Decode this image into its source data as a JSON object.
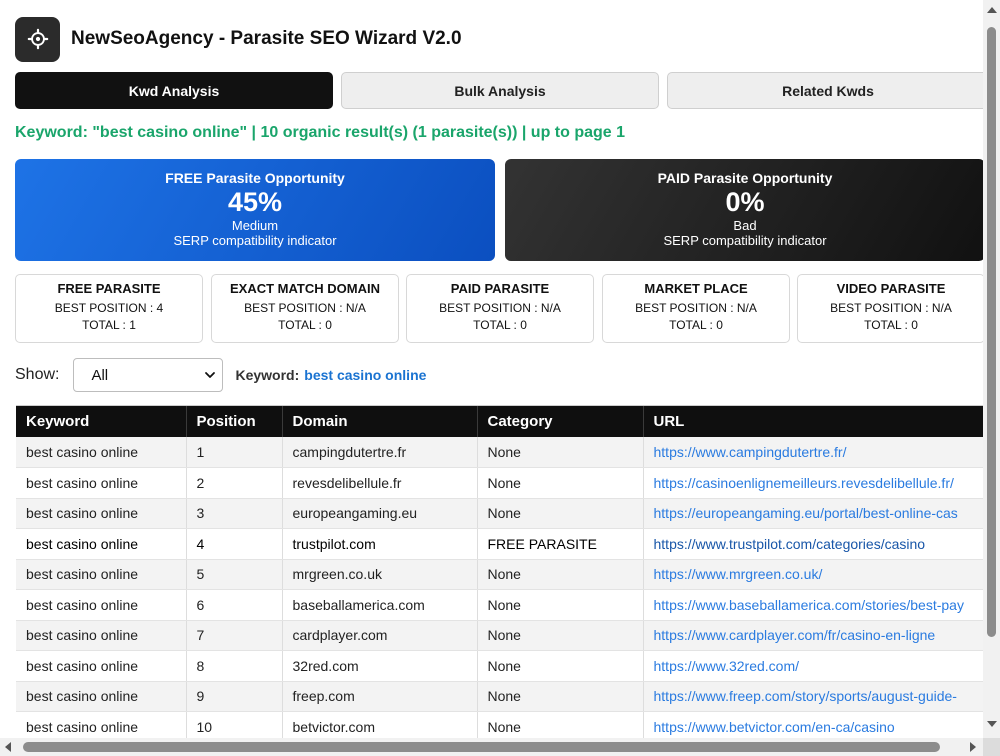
{
  "app": {
    "title": "NewSeoAgency - Parasite SEO Wizard V2.0",
    "logo_icon": "gear-icon"
  },
  "tabs": [
    {
      "label": "Kwd Analysis",
      "active": true
    },
    {
      "label": "Bulk Analysis",
      "active": false
    },
    {
      "label": "Related Kwds",
      "active": false
    }
  ],
  "summary": "Keyword: \"best casino online\" | 10 organic result(s) (1 parasite(s)) | up to page 1",
  "opportunities": {
    "free": {
      "title": "FREE Parasite Opportunity",
      "value": "45%",
      "rating": "Medium",
      "caption": "SERP compatibility indicator"
    },
    "paid": {
      "title": "PAID Parasite Opportunity",
      "value": "0%",
      "rating": "Bad",
      "caption": "SERP compatibility indicator"
    }
  },
  "stats": [
    {
      "name": "FREE PARASITE",
      "best": "BEST POSITION : 4",
      "total": "TOTAL : 1"
    },
    {
      "name": "EXACT MATCH DOMAIN",
      "best": "BEST POSITION : N/A",
      "total": "TOTAL : 0"
    },
    {
      "name": "PAID PARASITE",
      "best": "BEST POSITION : N/A",
      "total": "TOTAL : 0"
    },
    {
      "name": "MARKET PLACE",
      "best": "BEST POSITION : N/A",
      "total": "TOTAL : 0"
    },
    {
      "name": "VIDEO PARASITE",
      "best": "BEST POSITION : N/A",
      "total": "TOTAL : 0"
    }
  ],
  "filter": {
    "show_label": "Show:",
    "selected": "All",
    "keyword_label": "Keyword:",
    "keyword_value": "best casino online"
  },
  "table": {
    "headers": [
      "Keyword",
      "Position",
      "Domain",
      "Category",
      "URL"
    ],
    "rows": [
      {
        "keyword": "best casino online",
        "position": "1",
        "domain": "campingdutertre.fr",
        "category": "None",
        "url": "https://www.campingdutertre.fr/"
      },
      {
        "keyword": "best casino online",
        "position": "2",
        "domain": "revesdelibellule.fr",
        "category": "None",
        "url": "https://casinoenlignemeilleurs.revesdelibellule.fr/"
      },
      {
        "keyword": "best casino online",
        "position": "3",
        "domain": "europeangaming.eu",
        "category": "None",
        "url": "https://europeangaming.eu/portal/best-online-cas"
      },
      {
        "keyword": "best casino online",
        "position": "4",
        "domain": "trustpilot.com",
        "category": "FREE PARASITE",
        "url": "https://www.trustpilot.com/categories/casino"
      },
      {
        "keyword": "best casino online",
        "position": "5",
        "domain": "mrgreen.co.uk",
        "category": "None",
        "url": "https://www.mrgreen.co.uk/"
      },
      {
        "keyword": "best casino online",
        "position": "6",
        "domain": "baseballamerica.com",
        "category": "None",
        "url": "https://www.baseballamerica.com/stories/best-pay"
      },
      {
        "keyword": "best casino online",
        "position": "7",
        "domain": "cardplayer.com",
        "category": "None",
        "url": "https://www.cardplayer.com/fr/casino-en-ligne"
      },
      {
        "keyword": "best casino online",
        "position": "8",
        "domain": "32red.com",
        "category": "None",
        "url": "https://www.32red.com/"
      },
      {
        "keyword": "best casino online",
        "position": "9",
        "domain": "freep.com",
        "category": "None",
        "url": "https://www.freep.com/story/sports/august-guide-"
      },
      {
        "keyword": "best casino online",
        "position": "10",
        "domain": "betvictor.com",
        "category": "None",
        "url": "https://www.betvictor.com/en-ca/casino"
      }
    ]
  },
  "colors": {
    "summary_green": "#1aa56b",
    "free_blue": "#1e73e6",
    "paid_dark": "#222222",
    "link_blue": "#2a7be0",
    "header_black": "#0f0f0f"
  }
}
